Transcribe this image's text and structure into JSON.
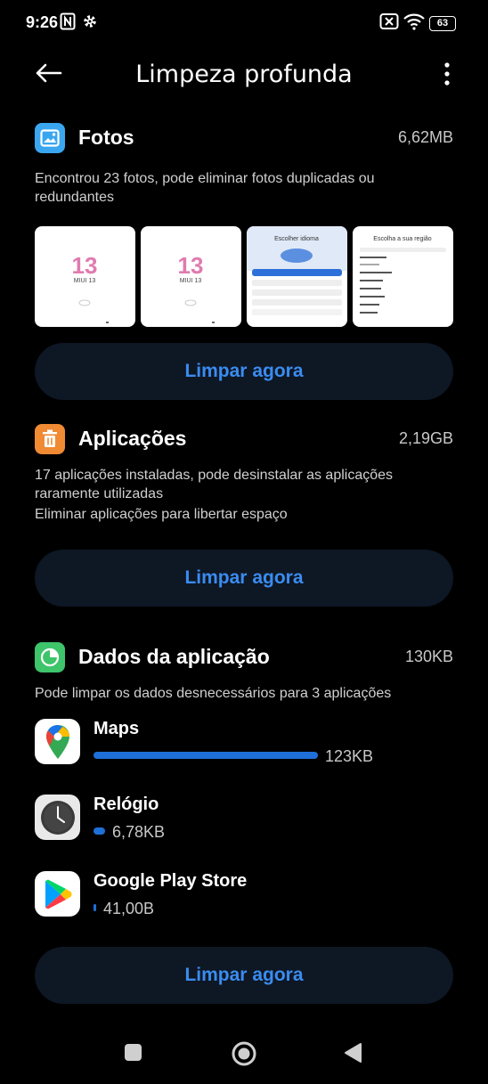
{
  "status": {
    "time": "9:26",
    "battery": "63"
  },
  "header": {
    "title": "Limpeza profunda"
  },
  "photos": {
    "title": "Fotos",
    "size": "6,62MB",
    "description": "Encontrou 23 fotos, pode eliminar fotos duplicadas ou redundantes",
    "button": "Limpar agora",
    "thumbs": [
      {
        "label": "MIUI 13"
      },
      {
        "label": "MIUI 13"
      },
      {
        "label": "Escolher idioma"
      },
      {
        "label": "Escolha a sua região"
      }
    ]
  },
  "apps": {
    "title": "Aplicações",
    "size": "2,19GB",
    "description": "17 aplicações instaladas, pode desinstalar as aplicações raramente utilizadas",
    "description2": "Eliminar aplicações para libertar espaço",
    "button": "Limpar agora"
  },
  "app_data": {
    "title": "Dados da aplicação",
    "size": "130KB",
    "description": "Pode limpar os dados desnecessários para 3 aplicações",
    "button": "Limpar agora",
    "items": [
      {
        "name": "Maps",
        "size": "123KB",
        "fill": 0.95,
        "icon": "maps-icon"
      },
      {
        "name": "Relógio",
        "size": "6,78KB",
        "fill": 0.05,
        "icon": "clock-icon"
      },
      {
        "name": "Google Play Store",
        "size": "41,00B",
        "fill": 0.01,
        "icon": "play-store-icon"
      }
    ]
  },
  "colors": {
    "accent": "#3a8cf0",
    "bar": "#1f6fd9",
    "photos_icon": "#3aa6f0",
    "apps_icon": "#f08a33",
    "data_icon": "#3ec46a"
  }
}
